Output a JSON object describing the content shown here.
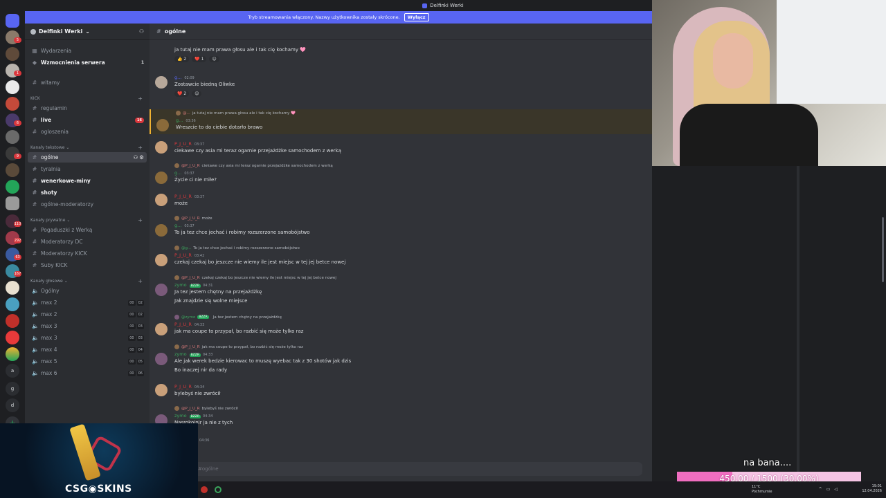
{
  "window": {
    "title": "Delfinki Werki"
  },
  "banner": {
    "text": "Tryb streamowania włączony. Nazwy użytkownika zostały skrócone.",
    "button": "Wyłącz"
  },
  "guild_badges": [
    "5",
    "1",
    "6",
    "9",
    "110",
    "292",
    "63",
    "167",
    "g",
    "a",
    "d"
  ],
  "sidebar": {
    "server_name": "Delfinki Werki",
    "top_items": [
      {
        "label": "Wydarzenia"
      },
      {
        "label": "Wzmocnienia serwera",
        "count": "1"
      }
    ],
    "channels": {
      "witamy": "witamy",
      "cat_kick": "KICK",
      "regulamin": "regulamin",
      "live": "live",
      "live_count": "16",
      "ogloszenia": "ogloszenia",
      "cat_text": "Kanały tekstowe",
      "ogolne": "ogólne",
      "tyralnia": "tyralnia",
      "wenerkowe": "wenerkowe-miny",
      "shoty": "shoty",
      "ogolne_mod": "ogólne-moderatorzy",
      "cat_private": "Kanały prywatne",
      "pogaduszki": "Pogaduszki z Werką",
      "mod_dc": "Moderatorzy DC",
      "mod_kick": "Moderatorzy KICK",
      "suby": "Suby KICK",
      "cat_voice": "Kanały głosowe",
      "voice_ogolny": "Ogólny"
    },
    "voice": [
      {
        "label": "max 2",
        "a": "00",
        "b": "02"
      },
      {
        "label": "max 2",
        "a": "00",
        "b": "02"
      },
      {
        "label": "max 3",
        "a": "00",
        "b": "03"
      },
      {
        "label": "max 3",
        "a": "00",
        "b": "03"
      },
      {
        "label": "max 4",
        "a": "00",
        "b": "04"
      },
      {
        "label": "max 5",
        "a": "00",
        "b": "05"
      },
      {
        "label": "max 6",
        "a": "00",
        "b": "06"
      }
    ]
  },
  "chat": {
    "channel": "ogólne",
    "composer_placeholder": "#ogólne",
    "messages": {
      "m1": {
        "text": "ja tutaj nie mam prawa głosu ale i tak cię kochamy 🩷",
        "r1": "👍 2",
        "r2": "❤️ 1"
      },
      "m2": {
        "user": "g...",
        "time": "02:09",
        "text": "Zostawcie biedną Oliwke",
        "r1": "❤️ 2"
      },
      "m3": {
        "reply": "ja tutaj nie mam prawa głosu ale i tak cię kochamy 🩷",
        "reply_user": "@...",
        "user": "g...",
        "time": "03:36",
        "text": "Wreszcie to do ciebie dotarło brawo"
      },
      "m4": {
        "user": "P_J_U_R",
        "time": "03:37",
        "text": "ciekawe czy asia mi teraz ogarnie przejażdżke samochodem z werką"
      },
      "m5": {
        "reply_user": "@P_J_U_R",
        "reply": "ciekawe czy asia mi teraz ogarnie przejażdżke samochodem z werką",
        "user": "g...",
        "time": "03:37",
        "text": "Życie ci nie miłe?"
      },
      "m6": {
        "user": "P_J_U_R",
        "time": "03:37",
        "text": "może"
      },
      "m7": {
        "reply_user": "@P_J_U_R",
        "reply": "może",
        "user": "g...",
        "time": "03:37",
        "text": "To ja tez chce jechać i robimy rozszerzone samobójstwo"
      },
      "m8": {
        "reply_user": "@g...",
        "reply": "To ja tez chce jechać i robimy rozszerzone samobójstwo",
        "user": "P_J_U_R",
        "time": "03:42",
        "text": "czekaj czekaj bo jeszcze nie wiemy ile jest miejsc w tej jej betce nowej"
      },
      "m9": {
        "reply_user": "@P_J_U_R",
        "reply": "czekaj czekaj bo jeszcze nie wiemy ile jest miejsc w tej jej betce nowej",
        "user": "zymo",
        "tag": "BZZR",
        "time": "04:31",
        "text": "Ja tez jestem chętny na przejażdżkę",
        "text2": "Jak znajdzie się wolne miejsce"
      },
      "m10": {
        "reply_user": "@zymo",
        "reply_tag": "BZZR",
        "reply": "Ja tez jestem chętny na przejażdżkę",
        "user": "P_J_U_R",
        "time": "04:33",
        "text": "jak ma coupe to przypał, bo rozbić się może tylko raz"
      },
      "m11": {
        "reply_user": "@P_J_U_R",
        "reply": "jak ma coupe to przypał, bo rozbić się może tylko raz",
        "user": "zymo",
        "tag": "BZZR",
        "time": "04:33",
        "text": "Ale jak werek bedzie kierowac to muszę wyebac tak z 30 shotów jak dzis",
        "text2": "Bo inaczej nir da rady"
      },
      "m12": {
        "user": "P_J_U_R",
        "time": "04:34",
        "text": "bylebyś nie zwrócił"
      },
      "m13": {
        "reply_user": "@P_J_U_R",
        "reply": "bylebyś nie zwrócił",
        "user": "zymo",
        "tag": "BZZR",
        "time": "04:34",
        "text": "Nasrokoinir ja nie z tych"
      },
      "m14": {
        "time": "04:36"
      }
    }
  },
  "overlay": {
    "logo": "CSG◉SKINS"
  },
  "goal": {
    "caption": "na bana....",
    "label": "450.00 / 1500 (30.00%)",
    "fraction": 0.3
  },
  "taskbar": {
    "weather_temp": "11°C",
    "weather_desc": "Pochmurnie",
    "time": "19:01",
    "date": "12.04.2026"
  }
}
